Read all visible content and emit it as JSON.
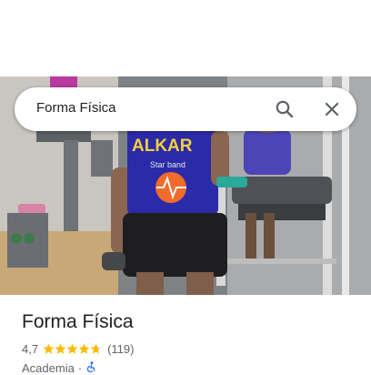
{
  "search": {
    "query": "Forma Física"
  },
  "place": {
    "name": "Forma Física",
    "rating": "4,7",
    "star_fill": [
      1,
      1,
      1,
      1,
      0.7
    ],
    "review_count": "(119)",
    "category": "Academia",
    "separator": "·"
  },
  "photo": {
    "shirt_text": "ALKAR",
    "shirt_subtext": "Star band"
  },
  "colors": {
    "star": "#fbbc04",
    "accessible_icon": "#1a73e8",
    "text_primary": "#202124",
    "text_secondary": "#5f6368"
  },
  "icons": {
    "search": "search-icon",
    "close": "close-icon",
    "wheelchair": "wheelchair-icon"
  }
}
